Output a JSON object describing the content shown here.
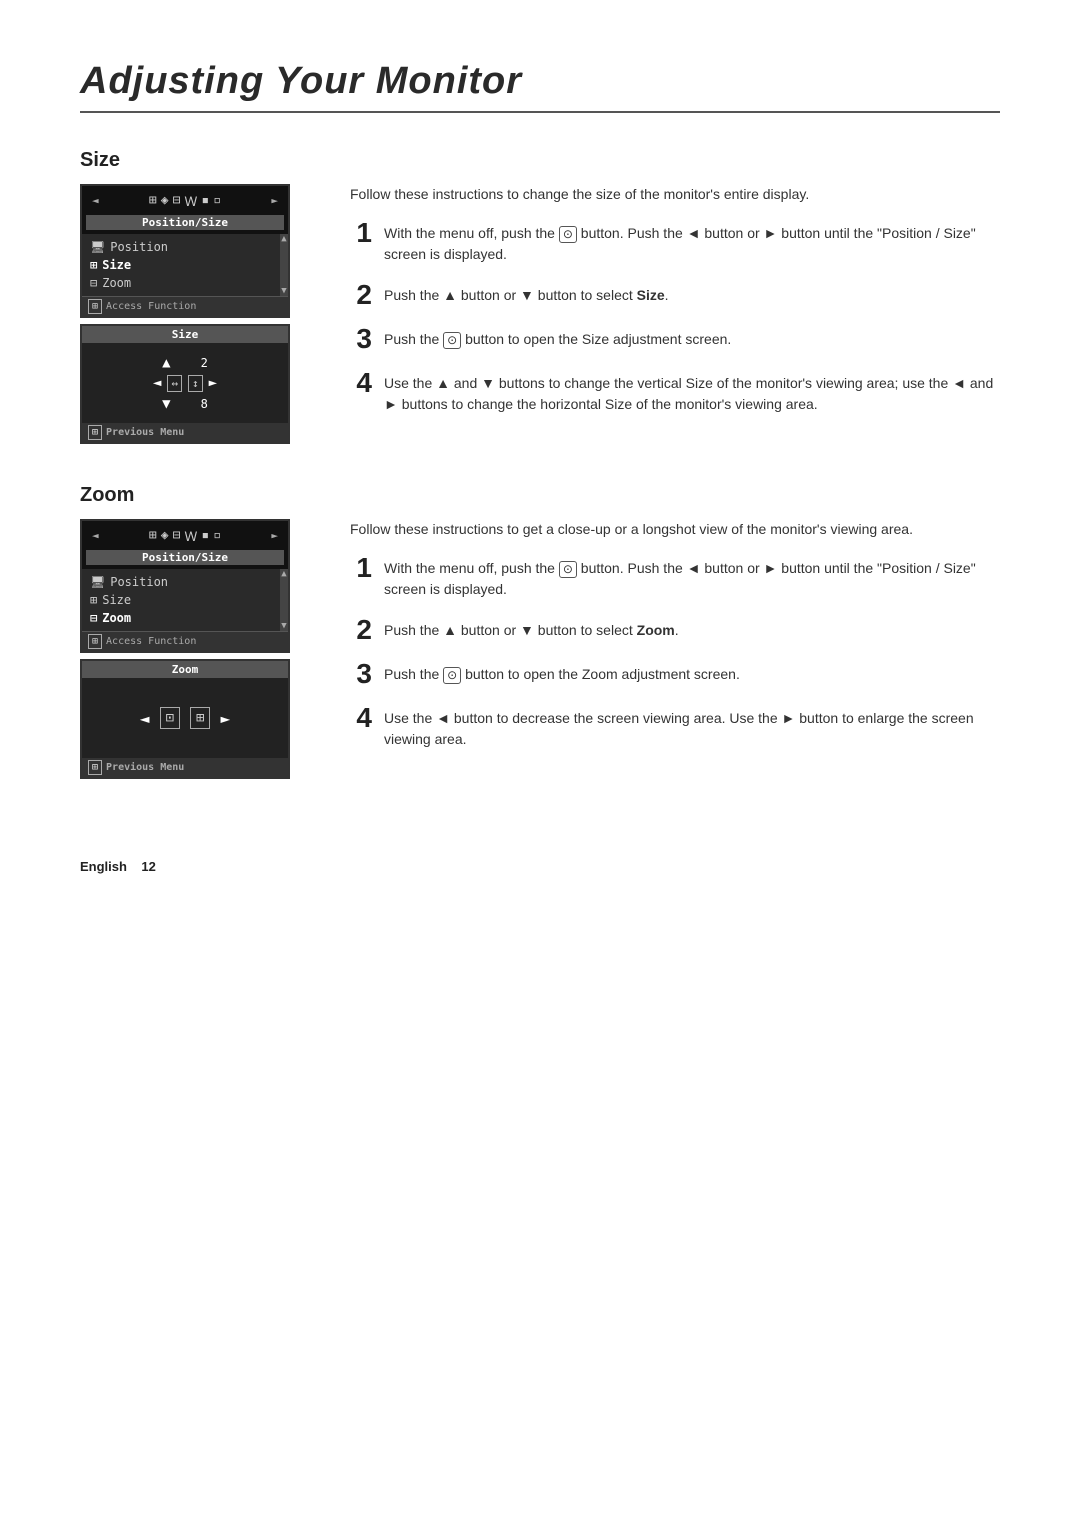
{
  "page": {
    "title": "Adjusting Your Monitor",
    "footer": {
      "language": "English",
      "page_number": "12"
    }
  },
  "sections": [
    {
      "id": "size",
      "heading": "Size",
      "intro": "Follow these instructions to change the size of the monitor's entire display.",
      "osd": {
        "top_label": "Position/Size",
        "menu_items": [
          "Position",
          "Size",
          "Zoom"
        ],
        "access_fn": "Access Function",
        "sub_screen_title": "Size",
        "prev_menu": "Previous Menu"
      },
      "steps": [
        {
          "num": "1",
          "text": "With the menu off, push the ⊙ button. Push the ◄ button or ► button until the \"Position / Size\" screen is displayed."
        },
        {
          "num": "2",
          "text": "Push the ▲ button or ▼ button to select Size."
        },
        {
          "num": "3",
          "text": "Push the ⊙ button to open the Size adjustment screen."
        },
        {
          "num": "4",
          "text": "Use the ▲ and ▼ buttons to change the vertical Size of the monitor's viewing area; use the ◄ and ► buttons to change the horizontal Size of the monitor's viewing area."
        }
      ]
    },
    {
      "id": "zoom",
      "heading": "Zoom",
      "intro": "Follow these instructions to get a close-up or a longshot view of the monitor's viewing area.",
      "osd": {
        "top_label": "Position/Size",
        "menu_items": [
          "Position",
          "Size",
          "Zoom"
        ],
        "access_fn": "Access Function",
        "sub_screen_title": "Zoom",
        "prev_menu": "Previous Menu"
      },
      "steps": [
        {
          "num": "1",
          "text": "With the menu off, push the ⊙ button. Push the ◄ button or ► button until the \"Position / Size\" screen is displayed."
        },
        {
          "num": "2",
          "text": "Push the ▲ button or ▼ button to select Zoom."
        },
        {
          "num": "3",
          "text": "Push the ⊙ button to open the Zoom adjustment screen."
        },
        {
          "num": "4",
          "text": "Use the ◄ button to decrease the screen viewing area. Use the ► button to enlarge the screen viewing area."
        }
      ]
    }
  ]
}
